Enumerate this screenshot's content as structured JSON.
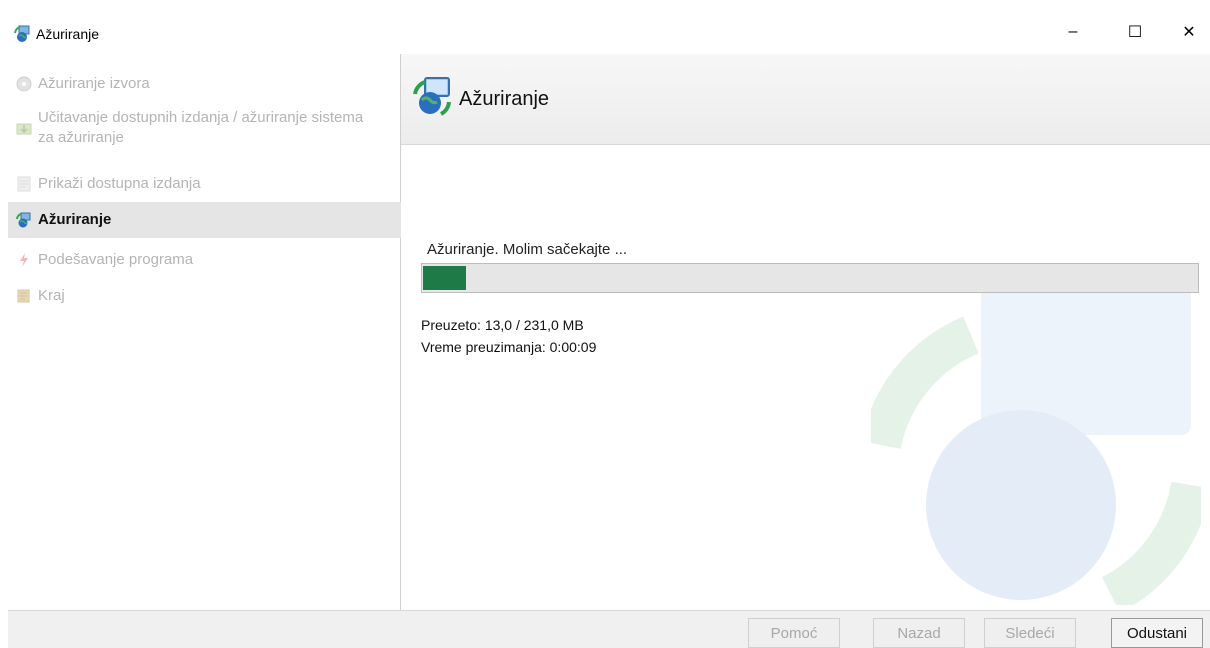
{
  "window": {
    "title": "Ažuriranje",
    "minimize_glyph": "–",
    "maximize_glyph": "☐",
    "close_glyph": "✕"
  },
  "sidebar": {
    "items": [
      {
        "label": "Ažuriranje izvora",
        "icon": "disc-icon",
        "state": "disabled"
      },
      {
        "label": "Učitavanje dostupnih izdanja / ažuriranje sistema za ažuriranje",
        "icon": "download-package-icon",
        "state": "disabled"
      },
      {
        "label": "Prikaži dostupna izdanja",
        "icon": "document-icon",
        "state": "disabled"
      },
      {
        "label": "Ažuriranje",
        "icon": "update-globe-icon",
        "state": "active"
      },
      {
        "label": "Podešavanje programa",
        "icon": "lightning-icon",
        "state": "disabled"
      },
      {
        "label": "Kraj",
        "icon": "finish-flag-icon",
        "state": "disabled"
      }
    ]
  },
  "header": {
    "title": "Ažuriranje",
    "icon": "update-globe-icon"
  },
  "main": {
    "status": "Ažuriranje. Molim sačekajte ...",
    "progress_fraction": 0.056,
    "downloaded": "Preuzeto: 13,0 / 231,0 MB",
    "download_time": "Vreme preuzimanja: 0:00:09"
  },
  "footer": {
    "help_label": "Pomoć",
    "back_label": "Nazad",
    "next_label": "Sledeći",
    "cancel_label": "Odustani"
  },
  "colors": {
    "progress_fill": "#1e7a46",
    "active_item_bg": "#e5e5e5"
  }
}
